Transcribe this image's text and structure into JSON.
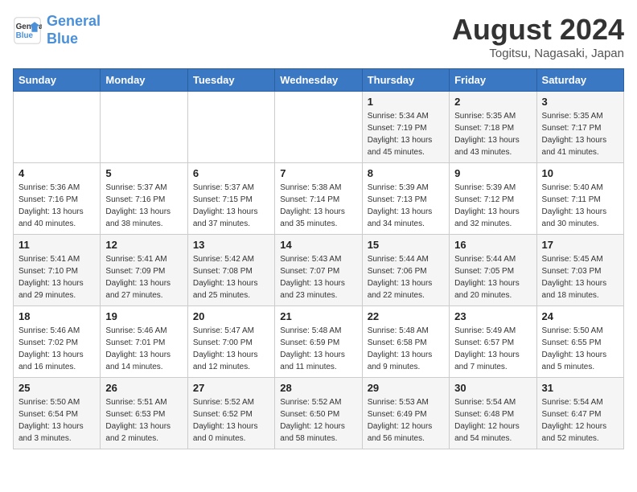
{
  "header": {
    "logo_line1": "General",
    "logo_line2": "Blue",
    "title": "August 2024",
    "subtitle": "Togitsu, Nagasaki, Japan"
  },
  "weekdays": [
    "Sunday",
    "Monday",
    "Tuesday",
    "Wednesday",
    "Thursday",
    "Friday",
    "Saturday"
  ],
  "weeks": [
    [
      {
        "day": "",
        "info": ""
      },
      {
        "day": "",
        "info": ""
      },
      {
        "day": "",
        "info": ""
      },
      {
        "day": "",
        "info": ""
      },
      {
        "day": "1",
        "info": "Sunrise: 5:34 AM\nSunset: 7:19 PM\nDaylight: 13 hours\nand 45 minutes."
      },
      {
        "day": "2",
        "info": "Sunrise: 5:35 AM\nSunset: 7:18 PM\nDaylight: 13 hours\nand 43 minutes."
      },
      {
        "day": "3",
        "info": "Sunrise: 5:35 AM\nSunset: 7:17 PM\nDaylight: 13 hours\nand 41 minutes."
      }
    ],
    [
      {
        "day": "4",
        "info": "Sunrise: 5:36 AM\nSunset: 7:16 PM\nDaylight: 13 hours\nand 40 minutes."
      },
      {
        "day": "5",
        "info": "Sunrise: 5:37 AM\nSunset: 7:16 PM\nDaylight: 13 hours\nand 38 minutes."
      },
      {
        "day": "6",
        "info": "Sunrise: 5:37 AM\nSunset: 7:15 PM\nDaylight: 13 hours\nand 37 minutes."
      },
      {
        "day": "7",
        "info": "Sunrise: 5:38 AM\nSunset: 7:14 PM\nDaylight: 13 hours\nand 35 minutes."
      },
      {
        "day": "8",
        "info": "Sunrise: 5:39 AM\nSunset: 7:13 PM\nDaylight: 13 hours\nand 34 minutes."
      },
      {
        "day": "9",
        "info": "Sunrise: 5:39 AM\nSunset: 7:12 PM\nDaylight: 13 hours\nand 32 minutes."
      },
      {
        "day": "10",
        "info": "Sunrise: 5:40 AM\nSunset: 7:11 PM\nDaylight: 13 hours\nand 30 minutes."
      }
    ],
    [
      {
        "day": "11",
        "info": "Sunrise: 5:41 AM\nSunset: 7:10 PM\nDaylight: 13 hours\nand 29 minutes."
      },
      {
        "day": "12",
        "info": "Sunrise: 5:41 AM\nSunset: 7:09 PM\nDaylight: 13 hours\nand 27 minutes."
      },
      {
        "day": "13",
        "info": "Sunrise: 5:42 AM\nSunset: 7:08 PM\nDaylight: 13 hours\nand 25 minutes."
      },
      {
        "day": "14",
        "info": "Sunrise: 5:43 AM\nSunset: 7:07 PM\nDaylight: 13 hours\nand 23 minutes."
      },
      {
        "day": "15",
        "info": "Sunrise: 5:44 AM\nSunset: 7:06 PM\nDaylight: 13 hours\nand 22 minutes."
      },
      {
        "day": "16",
        "info": "Sunrise: 5:44 AM\nSunset: 7:05 PM\nDaylight: 13 hours\nand 20 minutes."
      },
      {
        "day": "17",
        "info": "Sunrise: 5:45 AM\nSunset: 7:03 PM\nDaylight: 13 hours\nand 18 minutes."
      }
    ],
    [
      {
        "day": "18",
        "info": "Sunrise: 5:46 AM\nSunset: 7:02 PM\nDaylight: 13 hours\nand 16 minutes."
      },
      {
        "day": "19",
        "info": "Sunrise: 5:46 AM\nSunset: 7:01 PM\nDaylight: 13 hours\nand 14 minutes."
      },
      {
        "day": "20",
        "info": "Sunrise: 5:47 AM\nSunset: 7:00 PM\nDaylight: 13 hours\nand 12 minutes."
      },
      {
        "day": "21",
        "info": "Sunrise: 5:48 AM\nSunset: 6:59 PM\nDaylight: 13 hours\nand 11 minutes."
      },
      {
        "day": "22",
        "info": "Sunrise: 5:48 AM\nSunset: 6:58 PM\nDaylight: 13 hours\nand 9 minutes."
      },
      {
        "day": "23",
        "info": "Sunrise: 5:49 AM\nSunset: 6:57 PM\nDaylight: 13 hours\nand 7 minutes."
      },
      {
        "day": "24",
        "info": "Sunrise: 5:50 AM\nSunset: 6:55 PM\nDaylight: 13 hours\nand 5 minutes."
      }
    ],
    [
      {
        "day": "25",
        "info": "Sunrise: 5:50 AM\nSunset: 6:54 PM\nDaylight: 13 hours\nand 3 minutes."
      },
      {
        "day": "26",
        "info": "Sunrise: 5:51 AM\nSunset: 6:53 PM\nDaylight: 13 hours\nand 2 minutes."
      },
      {
        "day": "27",
        "info": "Sunrise: 5:52 AM\nSunset: 6:52 PM\nDaylight: 13 hours\nand 0 minutes."
      },
      {
        "day": "28",
        "info": "Sunrise: 5:52 AM\nSunset: 6:50 PM\nDaylight: 12 hours\nand 58 minutes."
      },
      {
        "day": "29",
        "info": "Sunrise: 5:53 AM\nSunset: 6:49 PM\nDaylight: 12 hours\nand 56 minutes."
      },
      {
        "day": "30",
        "info": "Sunrise: 5:54 AM\nSunset: 6:48 PM\nDaylight: 12 hours\nand 54 minutes."
      },
      {
        "day": "31",
        "info": "Sunrise: 5:54 AM\nSunset: 6:47 PM\nDaylight: 12 hours\nand 52 minutes."
      }
    ]
  ]
}
